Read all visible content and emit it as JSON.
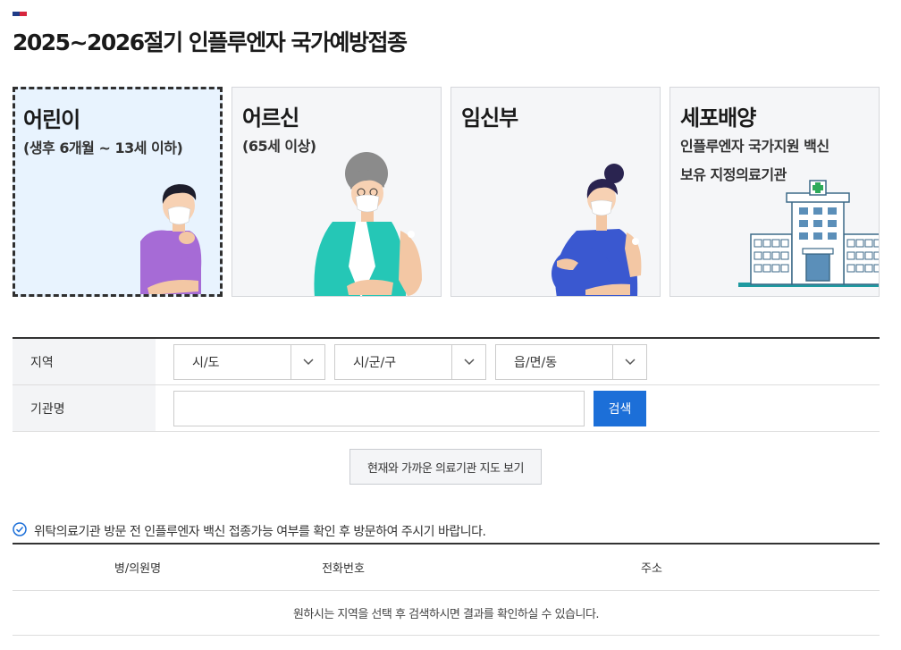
{
  "colors": {
    "flag_left": "#1f3c88",
    "flag_right": "#d7263d",
    "accent": "#1c6fd8",
    "active_card_bg": "#e8f3fe"
  },
  "page": {
    "title": "2025~2026절기 인플루엔자 국가예방접종"
  },
  "cards": [
    {
      "title": "어린이",
      "subtitle": "(생후 6개월 ~ 13세 이하)",
      "selected": true,
      "illustration": "child-illustration"
    },
    {
      "title": "어르신",
      "subtitle": "(65세 이상)",
      "selected": false,
      "illustration": "elder-illustration"
    },
    {
      "title": "임신부",
      "subtitle": "",
      "selected": false,
      "illustration": "pregnant-illustration"
    },
    {
      "title": "세포배양",
      "subtitle": "인플루엔자 국가지원 백신",
      "subtitle2": "보유 지정의료기관",
      "selected": false,
      "illustration": "hospital-illustration"
    }
  ],
  "search": {
    "region_label": "지역",
    "sido": "시/도",
    "sigungu": "시/군/구",
    "eupmyeondong": "읍/면/동",
    "org_label": "기관명",
    "org_value": "",
    "search_button": "검색",
    "chevron_icon": "chevron-down-icon"
  },
  "map_button": "현재와 가까운 의료기관 지도 보기",
  "notice": {
    "icon": "check-circle-icon",
    "text": "위탁의료기관 방문 전 인플루엔자 백신 접종가능 여부를 확인 후 방문하여 주시기 바랍니다."
  },
  "table": {
    "headers": [
      "병/의원명",
      "전화번호",
      "주소"
    ],
    "empty_message": "원하시는 지역을 선택 후 검색하시면 결과를 확인하실 수 있습니다."
  }
}
